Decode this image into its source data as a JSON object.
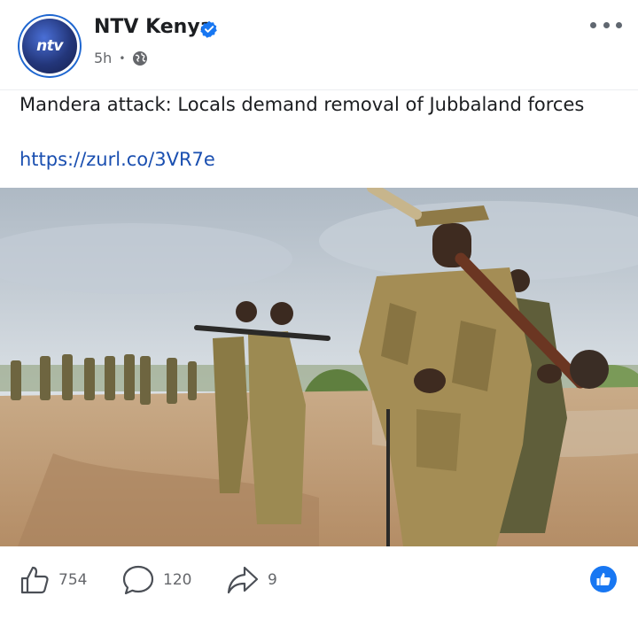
{
  "post": {
    "page_name": "NTV Kenya",
    "avatar_text": "ntv",
    "time_ago": "5h",
    "separator": "•",
    "privacy_icon": "globe-icon",
    "verified_icon": "verified-badge-icon",
    "more_icon": "more-options-icon",
    "headline": "Mandera attack: Locals demand removal of Jubbaland forces",
    "link": "https://zurl.co/3VR7e"
  },
  "photo": {
    "icon": "news-photo"
  },
  "actions": {
    "like": {
      "icon": "thumbs-up-icon",
      "count": "754"
    },
    "comment": {
      "icon": "comment-bubble-icon",
      "count": "120"
    },
    "share": {
      "icon": "share-arrow-icon",
      "count": "9"
    },
    "reaction_icon": "like-reaction-icon"
  },
  "colors": {
    "brand_blue": "#1877f2",
    "link_blue": "#1a4fb0",
    "muted_text": "#65676b"
  }
}
